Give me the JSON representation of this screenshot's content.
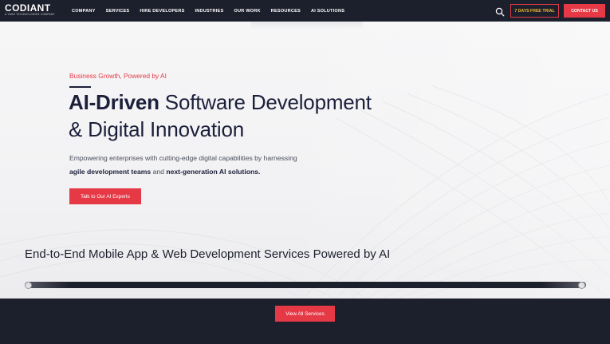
{
  "header": {
    "logo": {
      "name": "CODIANT",
      "tagline": "A YASH TECHNOLOGIES COMPANY"
    },
    "nav_items": [
      "COMPANY",
      "SERVICES",
      "HIRE DEVELOPERS",
      "INDUSTRIES",
      "OUR WORK",
      "RESOURCES",
      "AI SOLUTIONS"
    ],
    "search_icon": "search-icon",
    "trial_button": "7 DAYS FREE TRIAL",
    "contact_button": "CONTACT US"
  },
  "hero": {
    "eyebrow": "Business Growth, Powered by AI",
    "headline_bold": "AI-Driven",
    "headline_rest_line1": " Software Development",
    "headline_line2": "& Digital Innovation",
    "subtext_line1": "Empowering enterprises with cutting-edge digital capabilities by harnessing",
    "subtext_bold1": "agile development teams",
    "subtext_mid": " and ",
    "subtext_bold2": "next-generation AI solutions.",
    "cta_button": "Talk to Our AI Experts"
  },
  "services": {
    "section_title": "End-to-End Mobile App & Web Development Services Powered by AI",
    "view_all_button": "View All Services"
  },
  "colors": {
    "brand_dark": "#1c1f2c",
    "accent_red": "#e63946",
    "trial_text": "#f2b632"
  }
}
